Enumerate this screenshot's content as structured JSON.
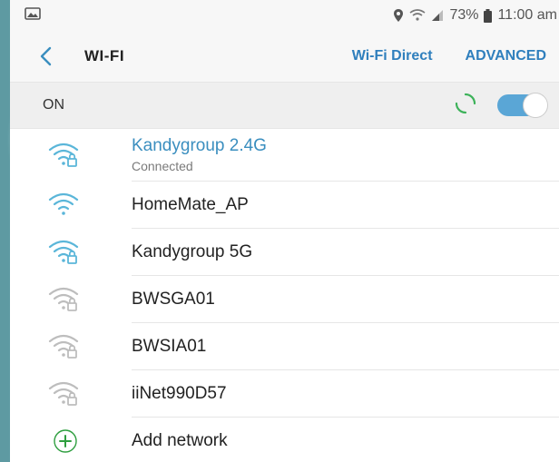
{
  "status": {
    "battery": "73%",
    "time": "11:00 am"
  },
  "appbar": {
    "title": "WI-FI",
    "wifi_direct": "Wi-Fi Direct",
    "advanced": "ADVANCED"
  },
  "toggle": {
    "label": "ON",
    "state": "on"
  },
  "networks": [
    {
      "name": "Kandygroup 2.4G",
      "status": "Connected",
      "secured": true,
      "strength": "full",
      "active": true
    },
    {
      "name": "HomeMate_AP",
      "status": "",
      "secured": false,
      "strength": "full",
      "active": false
    },
    {
      "name": "Kandygroup 5G",
      "status": "",
      "secured": true,
      "strength": "full",
      "active": false
    },
    {
      "name": "BWSGA01",
      "status": "",
      "secured": true,
      "strength": "weak",
      "active": false
    },
    {
      "name": "BWSIA01",
      "status": "",
      "secured": true,
      "strength": "weak",
      "active": false
    },
    {
      "name": "iiNet990D57",
      "status": "",
      "secured": true,
      "strength": "weak",
      "active": false
    }
  ],
  "add_network": {
    "label": "Add network"
  },
  "colors": {
    "accent": "#3a8ebf",
    "wifi_strong": "#5ab6d9",
    "wifi_weak": "#bdbdbd",
    "add_green": "#2e9e3f"
  }
}
